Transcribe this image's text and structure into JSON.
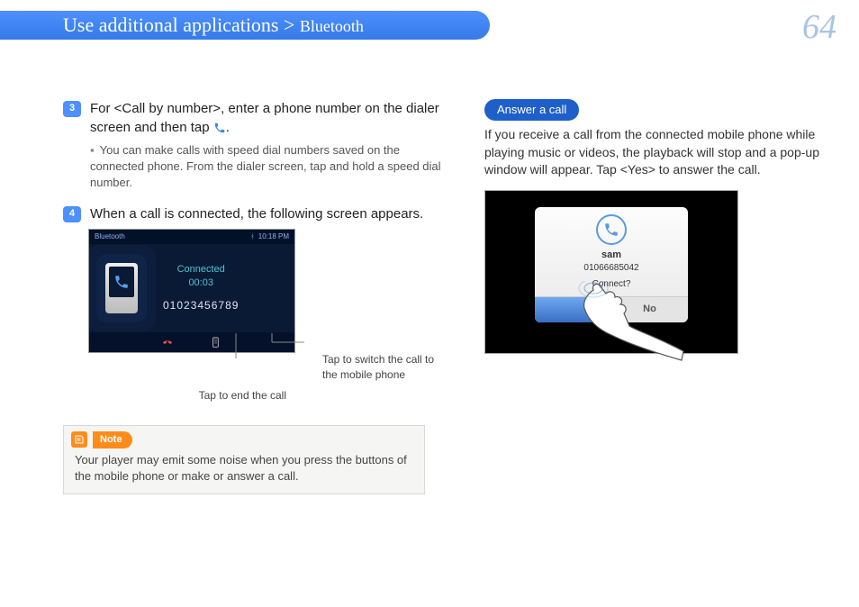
{
  "header": {
    "title_main": "Use additional applications > ",
    "title_sub": "Bluetooth"
  },
  "page_number": "64",
  "left": {
    "step3_num": "3",
    "step3_text": "For <Call by number>, enter a phone number on the dialer screen and then tap ",
    "step3_period": ".",
    "step3_sub": "You can make calls with speed dial numbers saved on the connected phone. From the dialer screen, tap and hold a speed dial number.",
    "step4_num": "4",
    "step4_text": "When a call is connected, the following screen appears.",
    "screenshot": {
      "title": "Bluetooth",
      "time": "10:18 PM",
      "status": "Connected",
      "duration": "00:03",
      "number": "01023456789"
    },
    "callout_switch": "Tap to switch the call to the mobile phone",
    "callout_end": "Tap to end the call",
    "note_label": "Note",
    "note_text": "Your player may emit some noise when you press the buttons of the mobile phone or make or answer a call."
  },
  "right": {
    "section_label": "Answer a call",
    "body": "If you receive a call from the connected mobile phone while playing music or videos, the playback will stop and a pop-up window will appear. Tap <Yes> to answer the call.",
    "popup": {
      "name": "sam",
      "number": "01066685042",
      "prompt": "Connect?",
      "no": "No"
    }
  }
}
